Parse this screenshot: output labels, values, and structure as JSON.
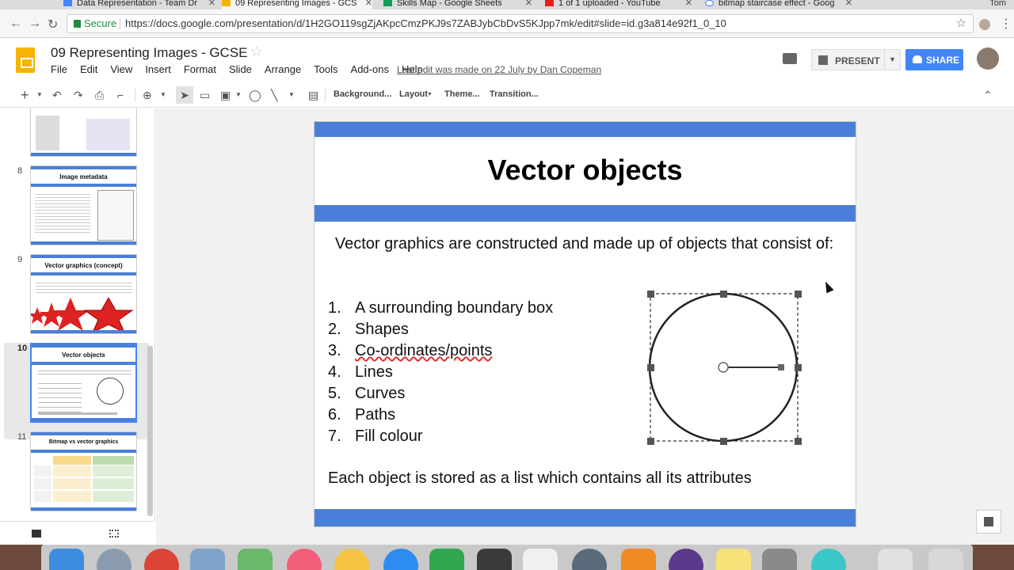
{
  "browser": {
    "tabs": [
      {
        "label": "Data Representation - Team Dr",
        "active": false
      },
      {
        "label": "09 Representing Images - GCS",
        "active": true
      },
      {
        "label": "Skills Map - Google Sheets",
        "active": false
      },
      {
        "label": "1 of 1 uploaded - YouTube",
        "active": false
      },
      {
        "label": "bitmap staircase effect - Goog",
        "active": false
      }
    ],
    "user": "Tom",
    "secure_label": "Secure",
    "url": "https://docs.google.com/presentation/d/1H2GO119sgZjAKpcCmzPKJ9s7ZABJybCbDvS5KJpp7mk/edit#slide=id.g3a814e92f1_0_10"
  },
  "docs": {
    "title": "09 Representing Images - GCSE",
    "menu": [
      "File",
      "Edit",
      "View",
      "Insert",
      "Format",
      "Slide",
      "Arrange",
      "Tools",
      "Add-ons",
      "Help"
    ],
    "last_edit": "Last edit was made on 22 July by Dan Copeman",
    "present_label": "PRESENT",
    "share_label": "SHARE"
  },
  "toolbar": {
    "background": "Background...",
    "layout": "Layout",
    "theme": "Theme...",
    "transition": "Transition..."
  },
  "filmstrip": {
    "slides": [
      {
        "num": "8",
        "title": "Image metadata",
        "active": false
      },
      {
        "num": "9",
        "title": "Vector graphics (concept)",
        "active": false
      },
      {
        "num": "10",
        "title": "Vector objects",
        "active": true
      },
      {
        "num": "11",
        "title": "Bitmap vs vector graphics",
        "active": false
      }
    ]
  },
  "slide": {
    "title": "Vector objects",
    "intro": "Vector graphics are constructed and made up of objects that consist of:",
    "list": [
      {
        "n": "1.",
        "text": "A surrounding boundary box"
      },
      {
        "n": "2.",
        "text": "Shapes"
      },
      {
        "n": "3.",
        "text": "Co-ordinates/points"
      },
      {
        "n": "4.",
        "text": "Lines"
      },
      {
        "n": "5.",
        "text": "Curves"
      },
      {
        "n": "6.",
        "text": "Paths"
      },
      {
        "n": "7.",
        "text": "Fill colour"
      }
    ],
    "footer": "Each object is stored as a list which contains all its attributes"
  },
  "colors": {
    "accent_blue": "#4a7fd9",
    "share_blue": "#4285f4",
    "slides_yellow": "#f4b400"
  }
}
